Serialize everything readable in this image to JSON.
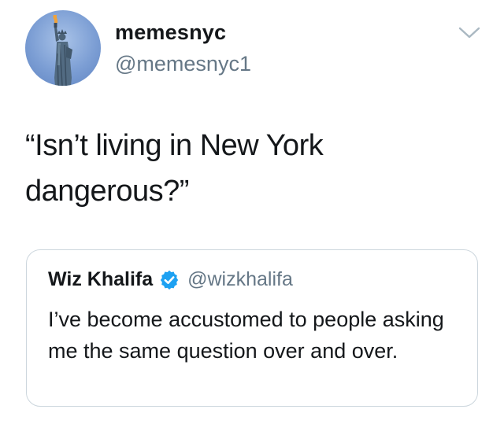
{
  "author": {
    "display_name": "memesnyc",
    "handle": "@memesnyc1",
    "avatar_icon": "statue-of-liberty-avatar"
  },
  "menu": {
    "icon": "chevron-down-icon"
  },
  "tweet": {
    "text": "“Isn’t living in New York dangerous?”"
  },
  "quote": {
    "display_name": "Wiz Khalifa",
    "verified_icon": "verified-badge-icon",
    "handle": "@wizkhalifa",
    "text": "I’ve become accustomed to people asking me the same question over and over."
  },
  "colors": {
    "text_primary": "#14171a",
    "text_secondary": "#657786",
    "verified_blue": "#1da1f2",
    "card_border": "#ccd6dd"
  }
}
